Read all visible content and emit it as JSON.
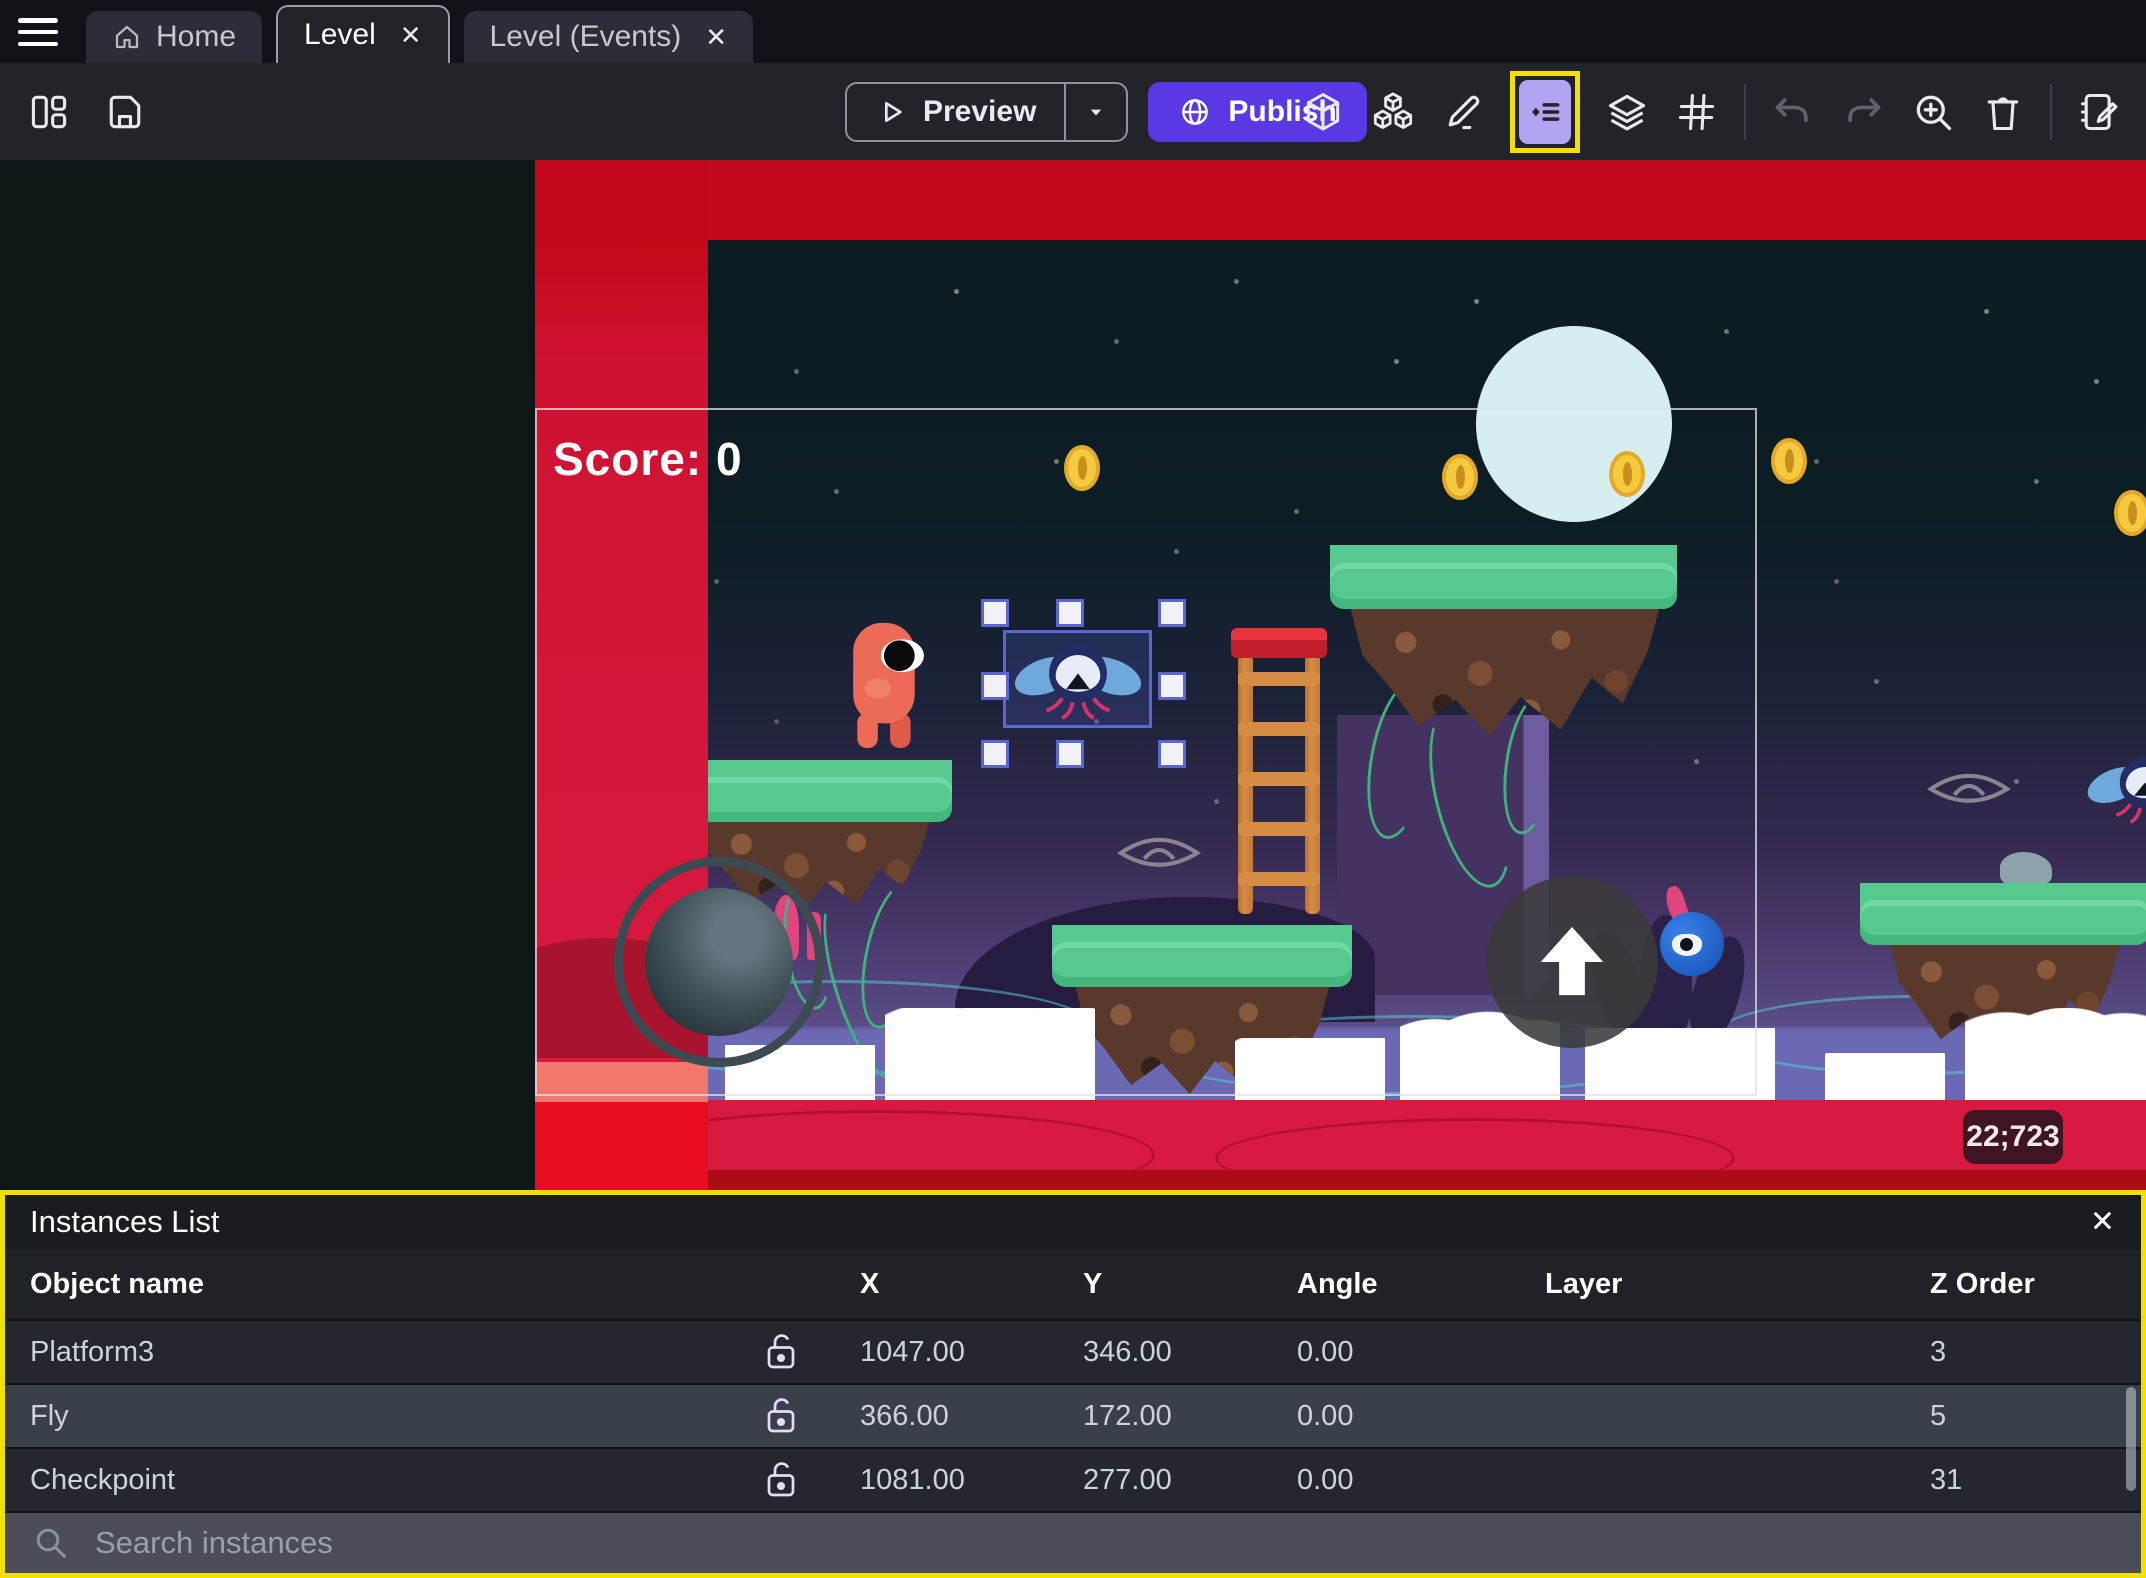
{
  "window": {
    "tabs": [
      {
        "label": "Home",
        "icon": "home-icon",
        "closable": false,
        "active": false
      },
      {
        "label": "Level",
        "closable": true,
        "active": true
      },
      {
        "label": "Level (Events)",
        "closable": true,
        "active": false
      }
    ]
  },
  "toolbar": {
    "preview_label": "Preview",
    "publish_label": "Publish",
    "left_icon_names": [
      "layout-panels-icon",
      "save-icon"
    ],
    "right_icon_names": [
      "cube-icon",
      "objects-stack-icon",
      "edit-pencil-icon",
      "instances-list-icon",
      "layers-icon",
      "grid-icon",
      "undo-icon",
      "redo-icon",
      "zoom-in-icon",
      "trash-icon",
      "scene-properties-icon"
    ],
    "highlighted_icon": "instances-list-icon"
  },
  "icons": {
    "close_glyph": "✕"
  },
  "scene": {
    "score_text": "Score: 0",
    "coords_badge": "22;723",
    "object_names": [
      "player-character",
      "fly-enemy",
      "coin",
      "platform",
      "ladder",
      "checkpoint",
      "joystick",
      "jump-button",
      "moon",
      "cloud"
    ]
  },
  "instances_panel": {
    "title": "Instances List",
    "columns": [
      "Object name",
      "X",
      "Y",
      "Angle",
      "Layer",
      "Z Order"
    ],
    "rows": [
      {
        "name": "Platform3",
        "x": "1047.00",
        "y": "346.00",
        "angle": "0.00",
        "layer": "",
        "z_order": "3"
      },
      {
        "name": "Fly",
        "x": "366.00",
        "y": "172.00",
        "angle": "0.00",
        "layer": "",
        "z_order": "5"
      },
      {
        "name": "Checkpoint",
        "x": "1081.00",
        "y": "277.00",
        "angle": "0.00",
        "layer": "",
        "z_order": "31"
      }
    ],
    "search_placeholder": "Search instances"
  },
  "colors": {
    "accent_purple": "#5a38e4",
    "highlight_yellow": "#f1e000",
    "selection_blue": "#5b66d6",
    "toolbar_icon_active_bg": "#b4a2f2",
    "scene_red_overlay": "#d5173c"
  }
}
